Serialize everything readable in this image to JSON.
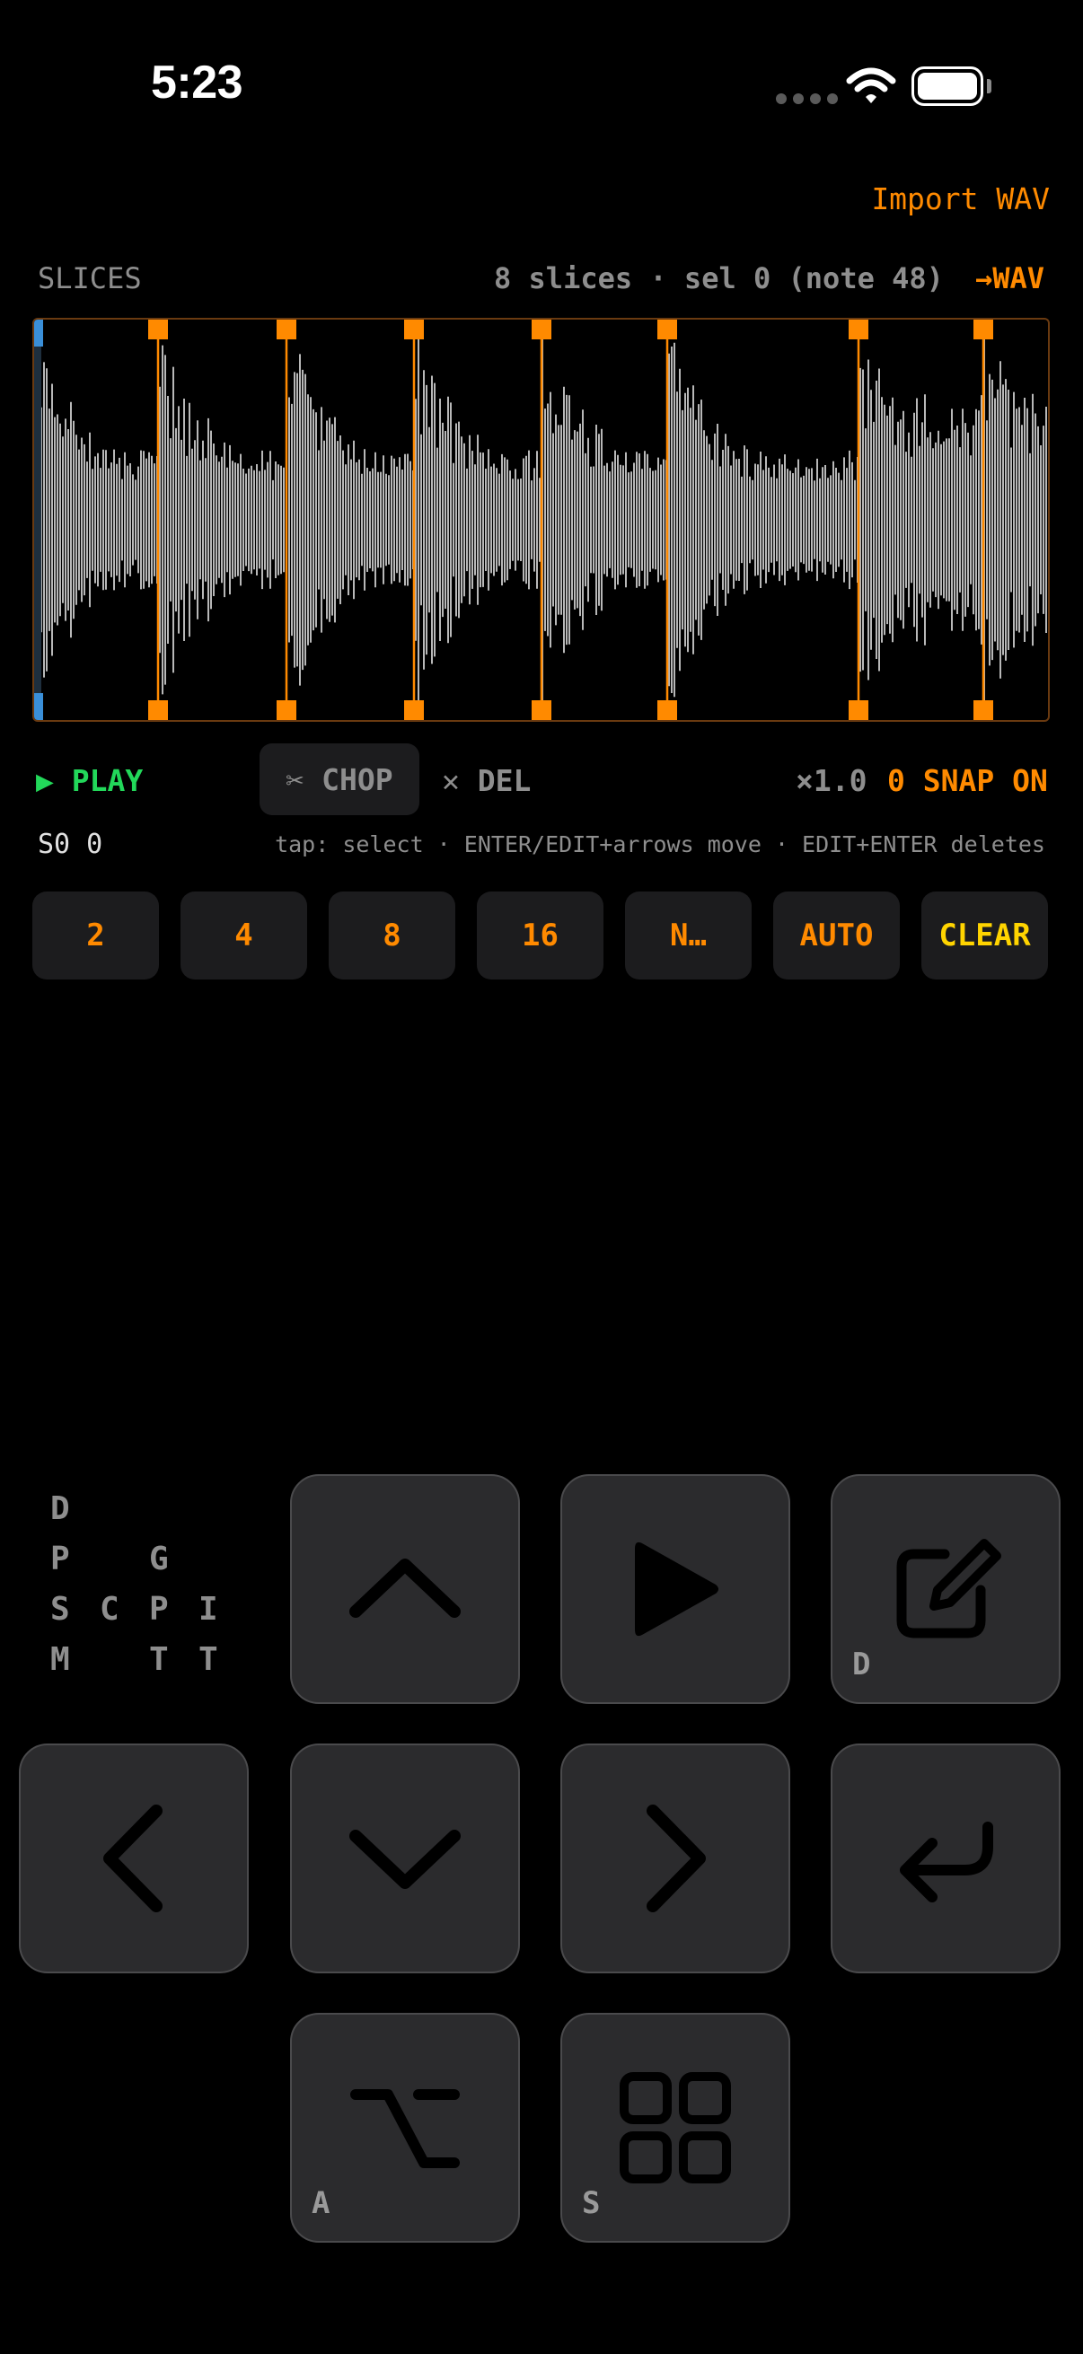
{
  "status": {
    "time": "5:23"
  },
  "header": {
    "import_label": "Import WAV"
  },
  "slices": {
    "title": "SLICES",
    "info": "8 slices · sel 0 (note 48)",
    "export_label": "→WAV",
    "slice_count": 8,
    "selected_index": 0
  },
  "transport": {
    "play_label": "▶ PLAY",
    "chop_label": "✂ CHOP",
    "del_label": "✕ DEL",
    "zoom_label": "×1.0",
    "snap_label": "0 SNAP ON",
    "position": "S0 0",
    "hint": "tap: select · ENTER/EDIT+arrows move · EDIT+ENTER deletes"
  },
  "chop_buttons": [
    "2",
    "4",
    "8",
    "16",
    "N…",
    "AUTO",
    "CLEAR"
  ],
  "mod_grid": [
    "D",
    "P",
    "G",
    "S",
    "C",
    "P",
    "I",
    "M",
    "T",
    "T"
  ],
  "keys": {
    "up": {
      "icon": "chevron-up-icon"
    },
    "play": {
      "icon": "play-icon"
    },
    "edit": {
      "icon": "edit-icon",
      "label": "D"
    },
    "left": {
      "icon": "chevron-left-icon"
    },
    "down": {
      "icon": "chevron-down-icon"
    },
    "right": {
      "icon": "chevron-right-icon"
    },
    "enter": {
      "icon": "enter-icon"
    },
    "option": {
      "icon": "option-icon",
      "label": "A"
    },
    "grid": {
      "icon": "grid-icon",
      "label": "S"
    }
  },
  "colors": {
    "accent": "#ff8a00",
    "play": "#22d85a",
    "clear": "#ffd400",
    "waveform": "#b8b8b8",
    "selection": "#3a8fd8"
  }
}
